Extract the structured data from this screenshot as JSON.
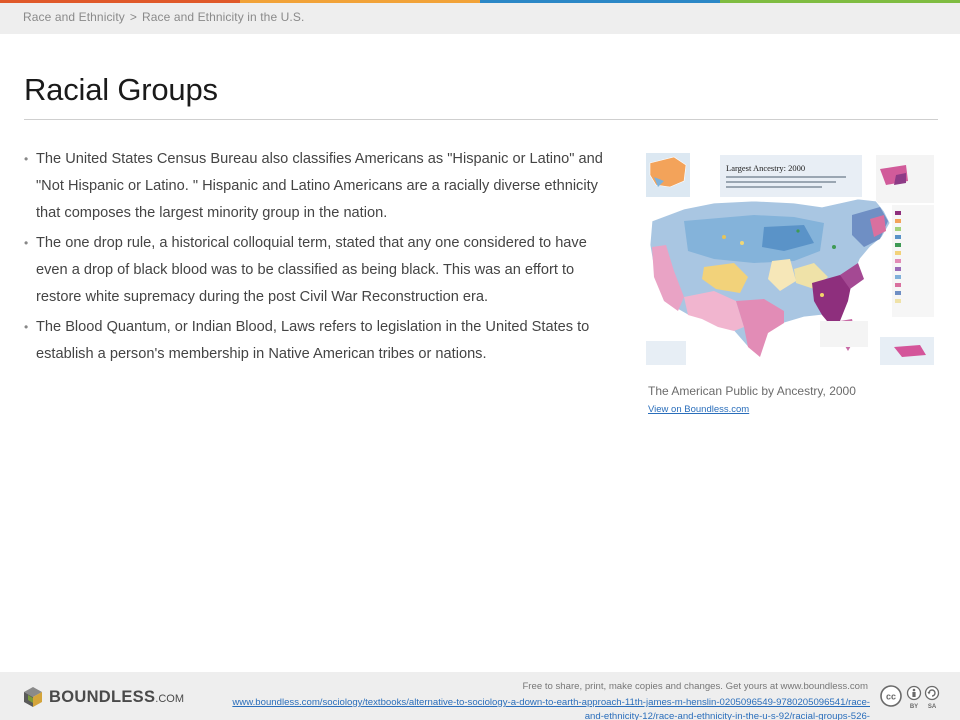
{
  "accent_colors": [
    "#e0592a",
    "#f1a238",
    "#2b87c6",
    "#7fbc41"
  ],
  "breadcrumb": {
    "parent": "Race and Ethnicity",
    "separator": ">",
    "current": "Race and Ethnicity in the U.S."
  },
  "page_title": "Racial Groups",
  "bullets": [
    "The United States Census Bureau also classifies Americans as \"Hispanic or Latino\" and \"Not Hispanic or Latino. \" Hispanic and Latino Americans are a racially diverse ethnicity that composes the largest minority group in the nation.",
    "The one drop rule, a historical colloquial term, stated that any one considered to have even a drop of black blood was to be classified as being black. This was an effort to restore white supremacy during the post Civil War Reconstruction era.",
    "The Blood Quantum, or Indian Blood, Laws refers to legislation in the United States to establish a person's membership in Native American tribes or nations."
  ],
  "bullet_glyph": "•",
  "figure": {
    "map_title": "Largest Ancestry: 2000",
    "caption": "The American Public by Ancestry, 2000",
    "link_text": "View on Boundless.com"
  },
  "footer": {
    "brand": "BOUNDLESS",
    "brand_suffix": ".COM",
    "share_text": "Free to share, print, make copies and changes. Get yours at www.boundless.com",
    "url_text": "www.boundless.com/sociology/textbooks/alternative-to-sociology-a-down-to-earth-approach-11th-james-m-henslin-0205096549-9780205096541/race-and-ethnicity-12/race-and-ethnicity-in-the-u-s-92/racial-groups-526-",
    "license_labels": [
      "BY",
      "SA"
    ]
  },
  "icons": [
    "boundless-logo-icon",
    "creative-commons-icon",
    "attribution-icon",
    "share-alike-icon"
  ]
}
